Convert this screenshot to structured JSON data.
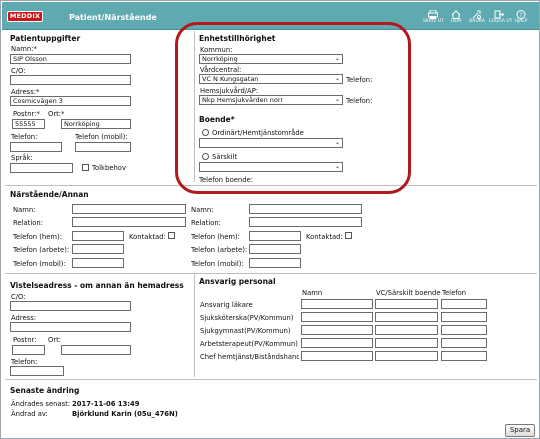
{
  "header": {
    "logo_text": "MEDDIX",
    "title": "Patient/Närstående",
    "tools": [
      {
        "label": "SKRIV UT",
        "icon": "printer-icon"
      },
      {
        "label": "HEM",
        "icon": "home-icon"
      },
      {
        "label": "BROKA",
        "icon": "tools-icon"
      },
      {
        "label": "LOGGA UT",
        "icon": "logout-icon"
      },
      {
        "label": "HJÄLP",
        "icon": "help-icon"
      }
    ]
  },
  "patient": {
    "heading": "Patientuppgifter",
    "namn_label": "Namn:*",
    "namn_value": "SIP Olsson",
    "co_label": "C/O:",
    "co_value": "",
    "adress_label": "Adress:*",
    "adress_value": "Cosmicvägen 3",
    "postnr_label": "Postnr:*",
    "postnr_value": "55555",
    "ort_label": "Ort:*",
    "ort_value": "Norrköping",
    "telefon_label": "Telefon:",
    "telefon_mobil_label": "Telefon (mobil):",
    "sprak_label": "Språk:",
    "tolkbehov_label": "Tolkbehov"
  },
  "enhet": {
    "heading": "Enhetstillhörighet",
    "kommun_label": "Kommun:",
    "kommun_value": "Norrköping",
    "vardcentral_label": "Vårdcentral:",
    "vardcentral_value": "VC N Kungsgatan",
    "hemsjukvard_label": "Hemsjukvård/AP:",
    "hemsjukvard_value": "Nkp Hemsjukvården norr",
    "telefon_label": "Telefon:"
  },
  "boende": {
    "heading": "Boende*",
    "option1": "Ordinärt/Hemtjänstområde",
    "option2": "Särskilt",
    "telefon_label": "Telefon boende:"
  },
  "narstaende": {
    "heading": "Närstående/Annan",
    "namn": "Namn:",
    "relation": "Relation:",
    "tel_hem": "Telefon (hem):",
    "kontaktad": "Kontaktad:",
    "tel_arbete": "Telefon (arbete):",
    "tel_mobil": "Telefon (mobil):"
  },
  "vistelse": {
    "heading": "Vistelseadress - om annan än hemadress",
    "co": "C/O:",
    "adress": "Adress:",
    "postnr": "Postnr:",
    "ort": "Ort:",
    "telefon": "Telefon:"
  },
  "personal": {
    "heading": "Ansvarig personal",
    "col_namn": "Namn",
    "col_vc": "VC/Särskilt boende",
    "col_tel": "Telefon",
    "roles": [
      "Ansvarig läkare",
      "Sjuksköterska(PV/Kommun)",
      "Sjukgymnast(PV/Kommun)",
      "Arbetsterapeut(PV/Kommun)",
      "Chef hemtjänst/Biståndshandl"
    ]
  },
  "andring": {
    "heading": "Senaste ändring",
    "andrades_label": "Ändrades senast:",
    "andrades_value": "2017-11-06 13:49",
    "andrad_av_label": "Ändrad av:",
    "andrad_av_value": "Björklund Karin (05u_476N)"
  },
  "footer": {
    "save_label": "Spara"
  }
}
